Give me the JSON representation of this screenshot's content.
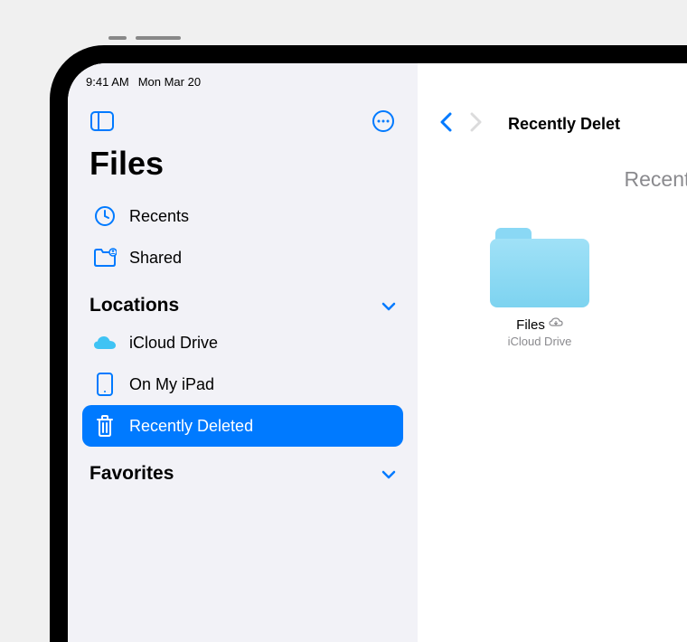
{
  "status": {
    "time": "9:41 AM",
    "date": "Mon Mar 20"
  },
  "sidebar": {
    "title": "Files",
    "nav": {
      "recents": "Recents",
      "shared": "Shared"
    },
    "sections": {
      "locations": {
        "title": "Locations",
        "items": {
          "icloud": "iCloud Drive",
          "onipad": "On My iPad",
          "deleted": "Recently Deleted"
        }
      },
      "favorites": {
        "title": "Favorites"
      }
    }
  },
  "main": {
    "title": "Recently Delet",
    "subtitle": "Recently",
    "folders": [
      {
        "name": "Files",
        "location": "iCloud Drive"
      }
    ]
  },
  "colors": {
    "accent": "#007aff",
    "sidebar_bg": "#f2f2f7",
    "text_secondary": "#8a8a8e"
  }
}
